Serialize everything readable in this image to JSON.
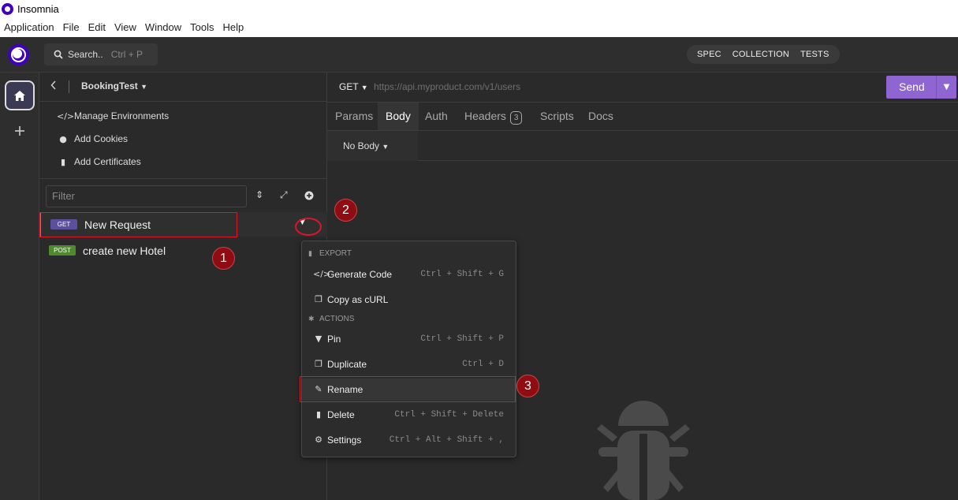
{
  "window": {
    "title": "Insomnia"
  },
  "menubar": {
    "items": [
      "Application",
      "File",
      "Edit",
      "View",
      "Window",
      "Tools",
      "Help"
    ]
  },
  "appbar": {
    "search_label": "Search..",
    "search_shortcut": "Ctrl + P",
    "mode_tabs": [
      "SPEC",
      "COLLECTION",
      "TESTS"
    ]
  },
  "sidebar": {
    "project": "BookingTest",
    "links": [
      "Manage Environments",
      "Add Cookies",
      "Add Certificates"
    ],
    "filter_placeholder": "Filter",
    "requests": [
      {
        "method": "GET",
        "name": "New Request",
        "color": "#5c4f9e"
      },
      {
        "method": "POST",
        "name": "create new Hotel",
        "color": "#4f8a2f"
      }
    ]
  },
  "request": {
    "method": "GET",
    "url_placeholder": "https://api.myproduct.com/v1/users",
    "send_label": "Send",
    "tabs": [
      "Params",
      "Body",
      "Auth",
      "Headers",
      "Scripts",
      "Docs"
    ],
    "active_tab": "Body",
    "headers_count": "3",
    "body_type": "No Body"
  },
  "context_menu": {
    "export_section": "EXPORT",
    "actions_section": "ACTIONS",
    "items": [
      {
        "label": "Generate Code",
        "shortcut": "Ctrl + Shift + G"
      },
      {
        "label": "Copy as cURL",
        "shortcut": ""
      },
      {
        "label": "Pin",
        "shortcut": "Ctrl + Shift + P"
      },
      {
        "label": "Duplicate",
        "shortcut": "Ctrl + D"
      },
      {
        "label": "Rename",
        "shortcut": ""
      },
      {
        "label": "Delete",
        "shortcut": "Ctrl + Shift + Delete"
      },
      {
        "label": "Settings",
        "shortcut": "Ctrl + Alt + Shift + ,"
      }
    ]
  },
  "annotations": [
    "1",
    "2",
    "3"
  ],
  "colors": {
    "accent": "#8e65d1",
    "brand": "#4000bf",
    "annotation": "#e0142b"
  }
}
